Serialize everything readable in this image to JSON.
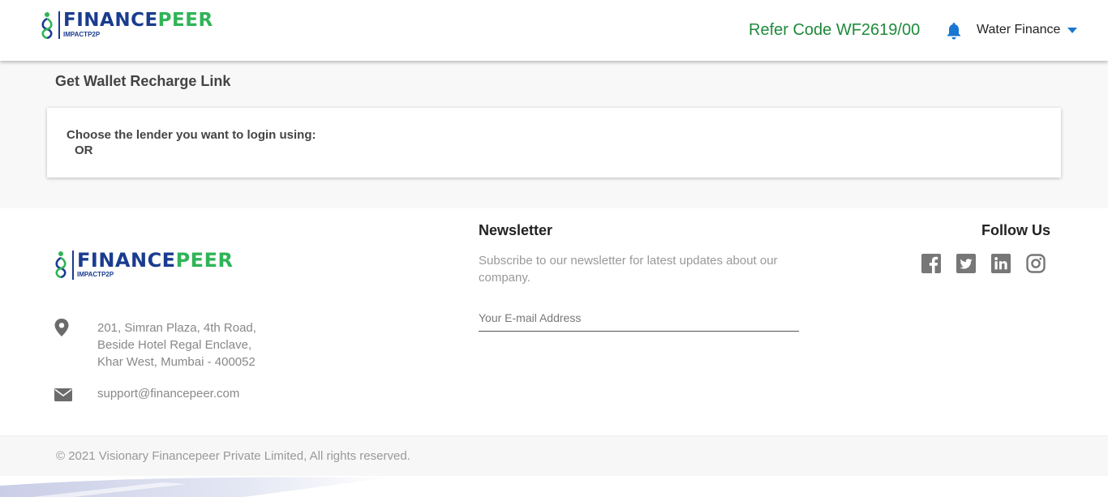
{
  "header": {
    "logo": {
      "brand_part1": "FINANCE",
      "brand_part2": "PEER",
      "tagline": "IMPACTP2P"
    },
    "refer_code": "Refer Code WF2619/00",
    "notification_icon": "bell-icon",
    "user_name": "Water Finance"
  },
  "main": {
    "page_title": "Get Wallet Recharge Link",
    "card": {
      "prompt": "Choose the lender you want to login using:",
      "or_text": "OR"
    }
  },
  "footer": {
    "logo": {
      "brand_part1": "FINANCE",
      "brand_part2": "PEER",
      "tagline": "IMPACTP2P"
    },
    "address_lines": [
      "201, Simran Plaza, 4th Road,",
      "Beside Hotel Regal Enclave,",
      "Khar West, Mumbai - 400052"
    ],
    "email": "support@financepeer.com",
    "newsletter": {
      "title": "Newsletter",
      "description": "Subscribe to our newsletter for latest updates about our company.",
      "email_placeholder": "Your E-mail Address"
    },
    "follow": {
      "title": "Follow Us",
      "icons": [
        "facebook-icon",
        "twitter-icon",
        "linkedin-icon",
        "instagram-icon"
      ]
    },
    "copyright": "© 2021 Visionary Financepeer Private Limited, All rights reserved."
  },
  "colors": {
    "brand_blue": "#1a3c8f",
    "brand_green": "#2fb457",
    "refer_green": "#1f8a3b",
    "accent_blue": "#1976d2",
    "social_gray": "#777777"
  }
}
